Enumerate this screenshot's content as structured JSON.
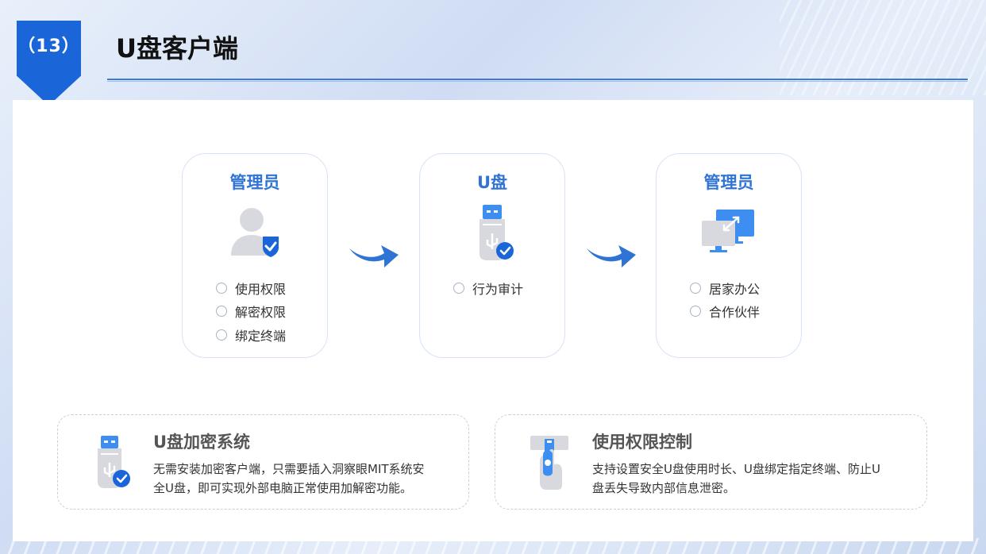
{
  "header": {
    "number": "（13）",
    "title": "U盘客户端"
  },
  "flow": {
    "cards": [
      {
        "title": "管理员",
        "icon": "admin-user-shield-icon",
        "options": [
          "使用权限",
          "解密权限",
          "绑定终端"
        ]
      },
      {
        "title": "U盘",
        "icon": "usb-drive-check-icon",
        "options": [
          "行为审计"
        ]
      },
      {
        "title": "管理员",
        "icon": "two-monitors-icon",
        "options": [
          "居家办公",
          "合作伙伴"
        ]
      }
    ]
  },
  "features": [
    {
      "title": "U盘加密系统",
      "icon": "usb-drive-check-icon",
      "desc_line1": "无需安装加密客户端，只需要插入洞察眼MIT系统安",
      "desc_line2": "全U盘，即可实现外部电脑正常使用加解密功能。"
    },
    {
      "title": "使用权限控制",
      "icon": "hand-insert-usb-icon",
      "desc_line1": "支持设置安全U盘使用时长、U盘绑定指定终端、防止U",
      "desc_line2": "盘丢失导致内部信息泄密。"
    }
  ],
  "colors": {
    "accent": "#1a66d8",
    "card_title": "#2f74d4",
    "icon_blue": "#3d8ef0"
  }
}
